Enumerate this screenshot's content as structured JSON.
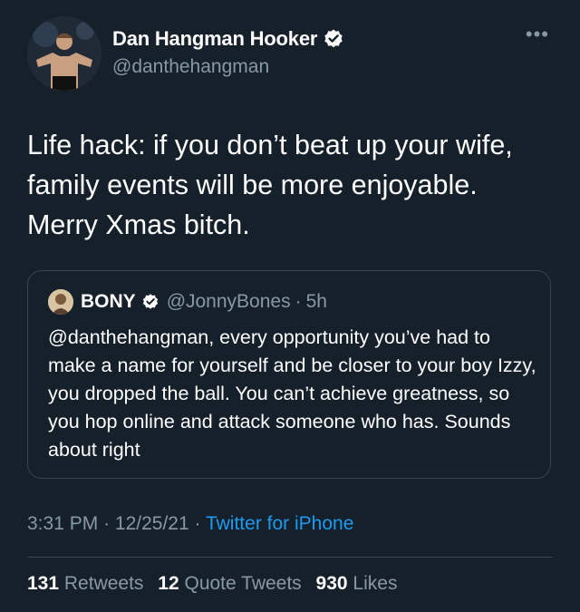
{
  "author": {
    "name": "Dan Hangman Hooker",
    "handle": "@danthehangman"
  },
  "tweet": {
    "text": "Life hack: if you don’t beat up your wife, family events will be more enjoyable. Merry Xmas bitch."
  },
  "quote": {
    "name": "BONY",
    "handle": "@JonnyBones",
    "separator": "·",
    "time": "5h",
    "text": "@danthehangman, every opportunity you’ve had to make a name for yourself and be closer to your boy Izzy, you dropped the ball. You can’t achieve greatness, so you hop online and attack someone who has. Sounds about right"
  },
  "meta": {
    "time": "3:31 PM",
    "separator": "·",
    "date": "12/25/21",
    "source": "Twitter for iPhone"
  },
  "stats": {
    "retweets_count": "131",
    "retweets_label": "Retweets",
    "quotes_count": "12",
    "quotes_label": "Quote Tweets",
    "likes_count": "930",
    "likes_label": "Likes"
  },
  "icons": {
    "verified": "verified-badge-icon",
    "more": "more-horizontal-icon"
  },
  "colors": {
    "background": "#15202b",
    "secondary_text": "#8899a6",
    "link": "#1d9bf0",
    "border": "#38444d"
  }
}
